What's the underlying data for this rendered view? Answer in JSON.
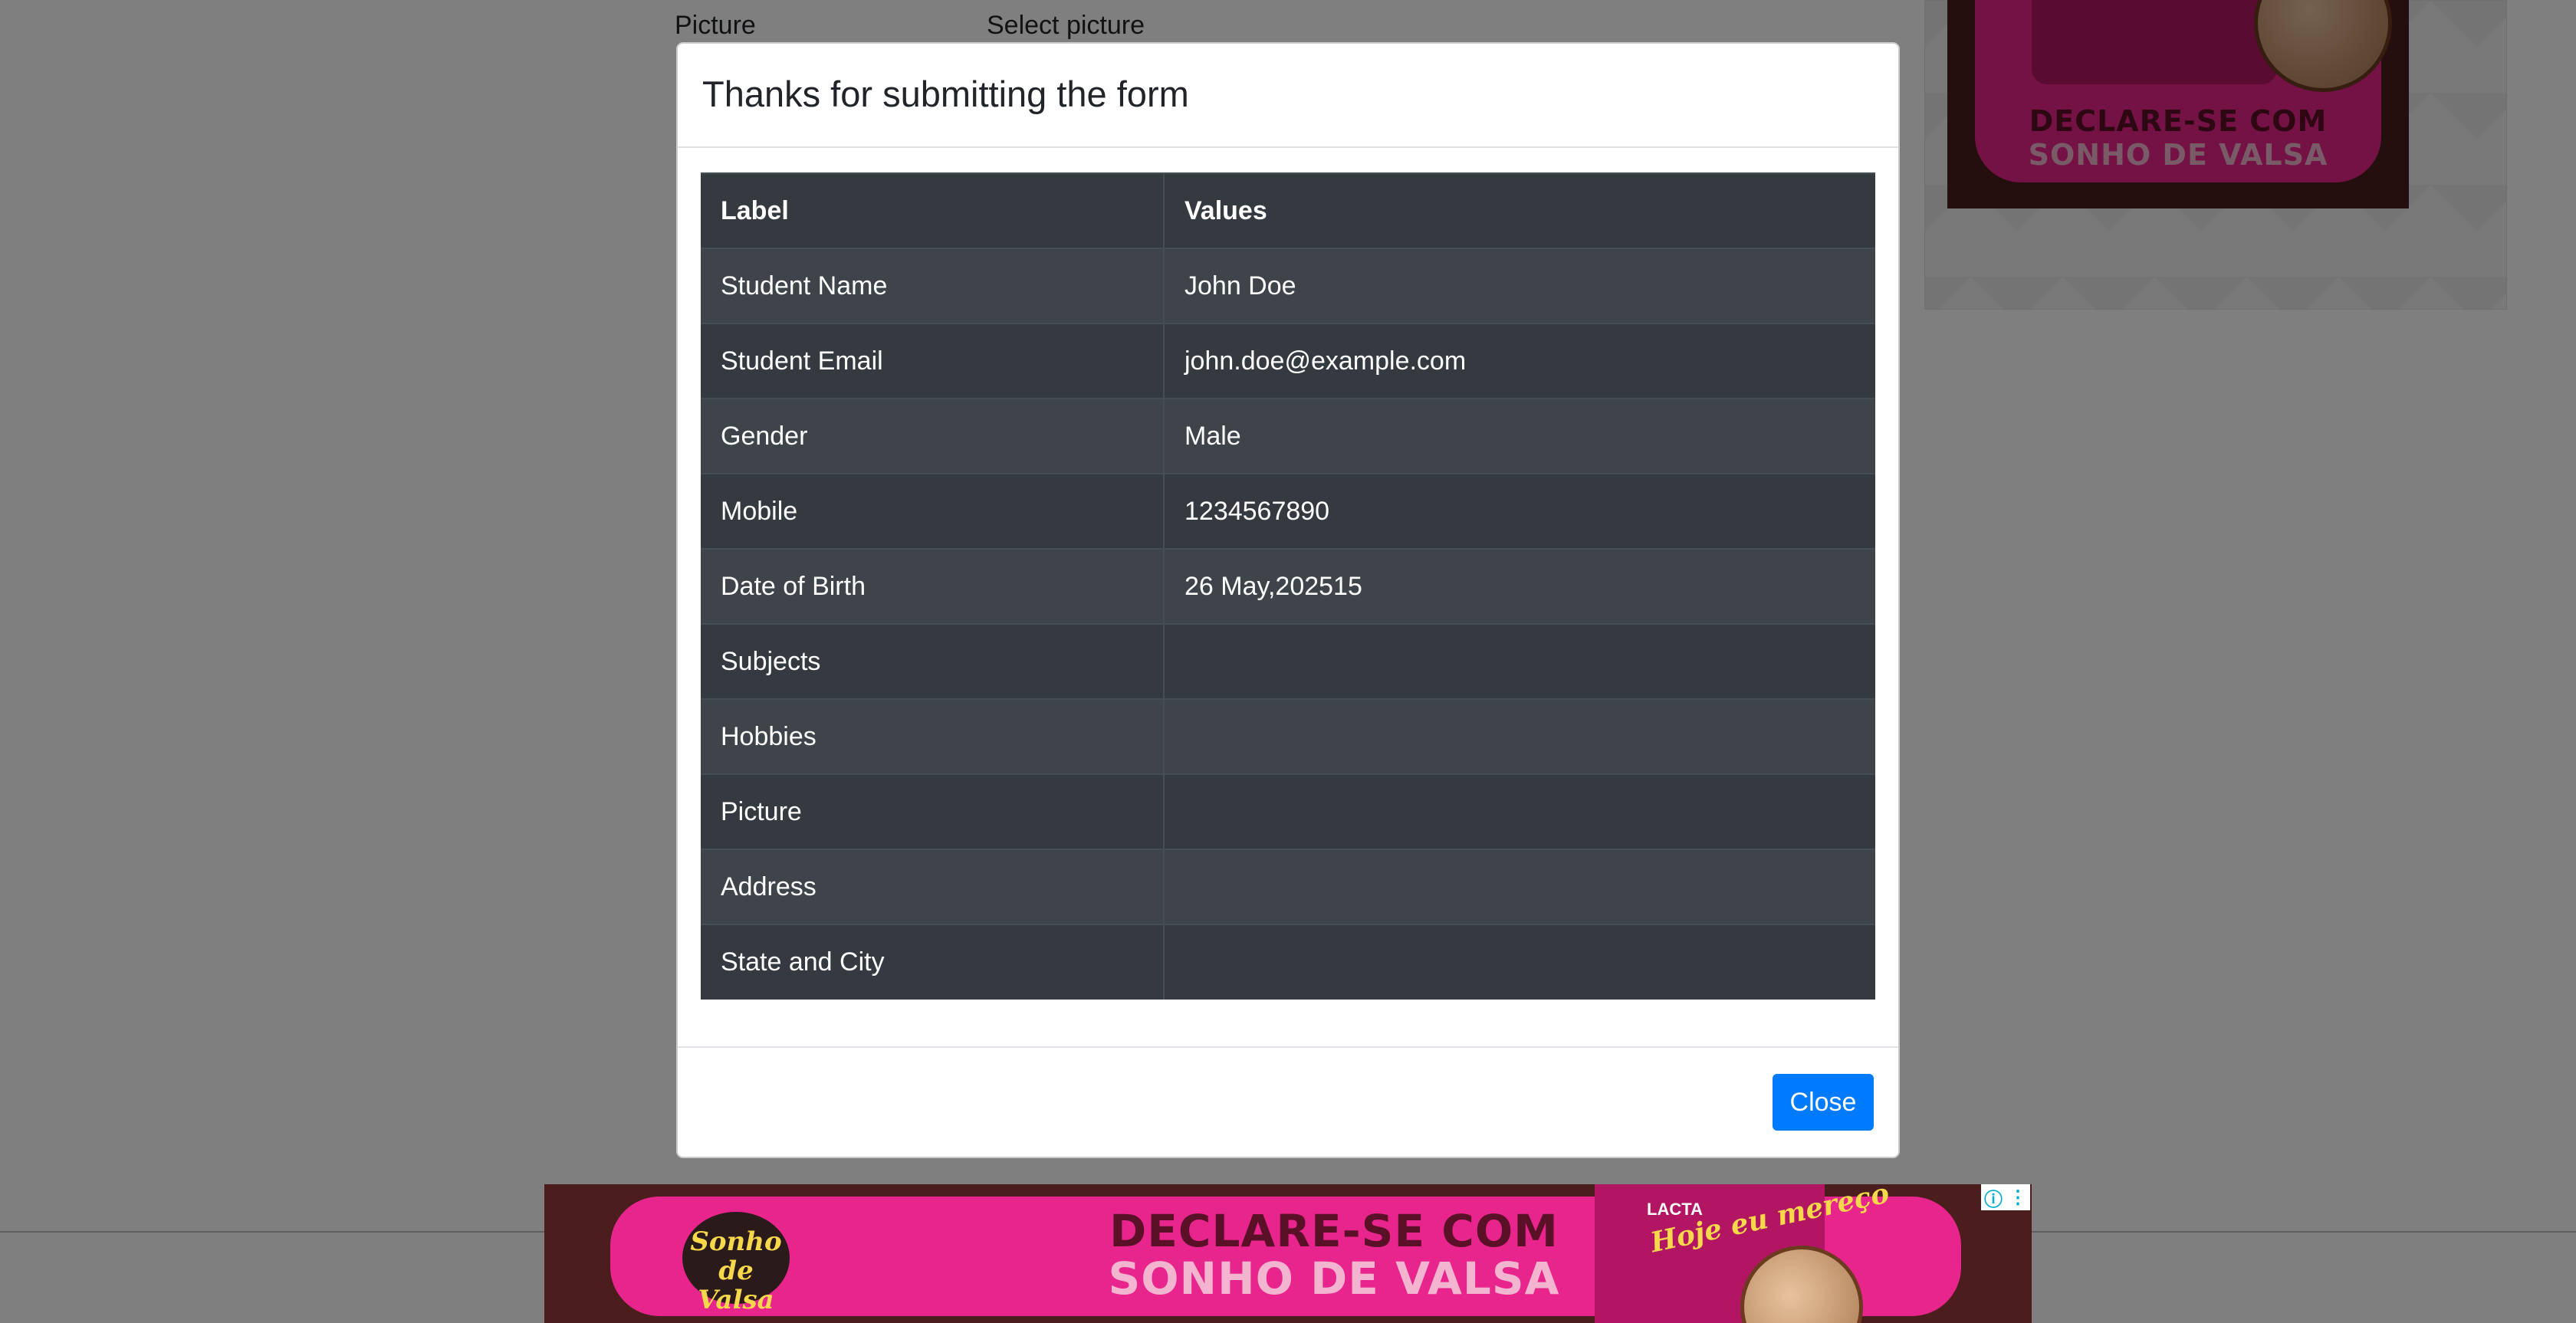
{
  "background": {
    "picture_label": "Picture",
    "select_picture_text": "Select picture"
  },
  "modal": {
    "title": "Thanks for submitting the form",
    "table": {
      "headers": [
        "Label",
        "Values"
      ],
      "rows": [
        {
          "label": "Student Name",
          "value": "John Doe"
        },
        {
          "label": "Student Email",
          "value": "john.doe@example.com"
        },
        {
          "label": "Gender",
          "value": "Male"
        },
        {
          "label": "Mobile",
          "value": "1234567890"
        },
        {
          "label": "Date of Birth",
          "value": "26 May,202515"
        },
        {
          "label": "Subjects",
          "value": ""
        },
        {
          "label": "Hobbies",
          "value": ""
        },
        {
          "label": "Picture",
          "value": ""
        },
        {
          "label": "Address",
          "value": ""
        },
        {
          "label": "State and City",
          "value": ""
        }
      ]
    },
    "close_label": "Close"
  },
  "ads": {
    "side": {
      "headline_line1": "DECLARE-SE COM",
      "headline_line2": "SONHO DE VALSA"
    },
    "bottom": {
      "logo_text": "Sonho de Valsa",
      "headline_line1": "DECLARE-SE COM",
      "headline_line2": "SONHO DE VALSA",
      "brand": "LACTA",
      "product_text": "Hoje eu mereço"
    },
    "choices_icons": [
      "info-icon",
      "more-vertical-icon"
    ]
  },
  "colors": {
    "primary_button": "#007bff",
    "table_dark": "#343a40",
    "ad_pink": "#e8258c"
  }
}
